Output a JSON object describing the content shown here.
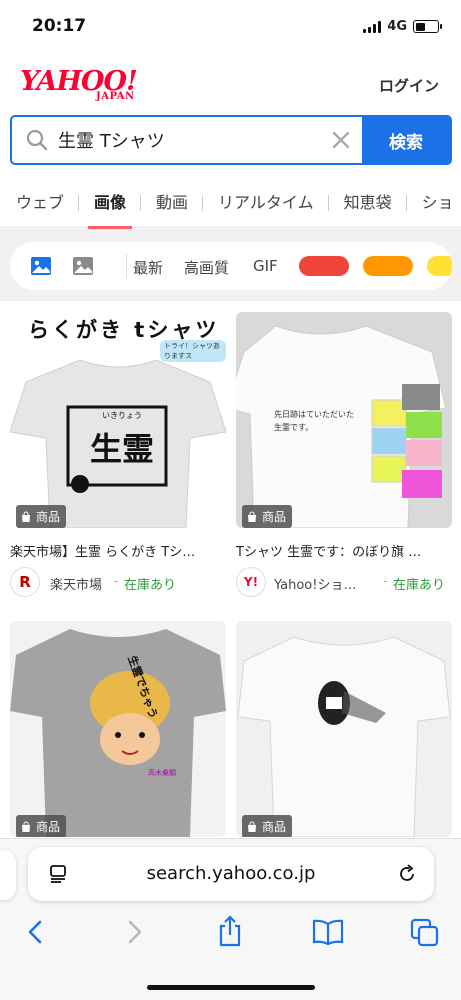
{
  "status": {
    "time": "20:17",
    "network": "4G"
  },
  "header": {
    "logo_main": "YAHOO!",
    "logo_sub": "JAPAN",
    "login": "ログイン"
  },
  "search": {
    "query": "生霊 Tシャツ",
    "button": "検索"
  },
  "tabs": [
    "ウェブ",
    "画像",
    "動画",
    "リアルタイム",
    "知恵袋",
    "ショ"
  ],
  "filters": {
    "latest": "最新",
    "hq": "高画質",
    "gif": "GIF",
    "colors": [
      "#f0453a",
      "#ff9800",
      "#ffe033"
    ]
  },
  "results": [
    {
      "title": "楽天市場】生霊 らくがき Tシ…",
      "badge": "商品",
      "shop": "楽天市場",
      "shop_logo": "R",
      "stock": "在庫あり",
      "image_text": "らくがき tシャツ",
      "image_tag": "トライ！シャツありますス",
      "image_sub": "いきりょう",
      "image_main": "生霊"
    },
    {
      "title": "Tシャツ 生霊です：のぼり旗 …",
      "badge": "商品",
      "shop": "Yahoo!ショ…",
      "shop_logo": "Y!",
      "stock": "在庫あり",
      "image_line1": "先日跡はていただいた",
      "image_line2": "生霊です。"
    },
    {
      "badge": "商品",
      "image_text": "生霊でちゃう",
      "image_sub": "高木桑類"
    },
    {
      "badge": "商品"
    }
  ],
  "browser": {
    "url": "search.yahoo.co.jp"
  }
}
